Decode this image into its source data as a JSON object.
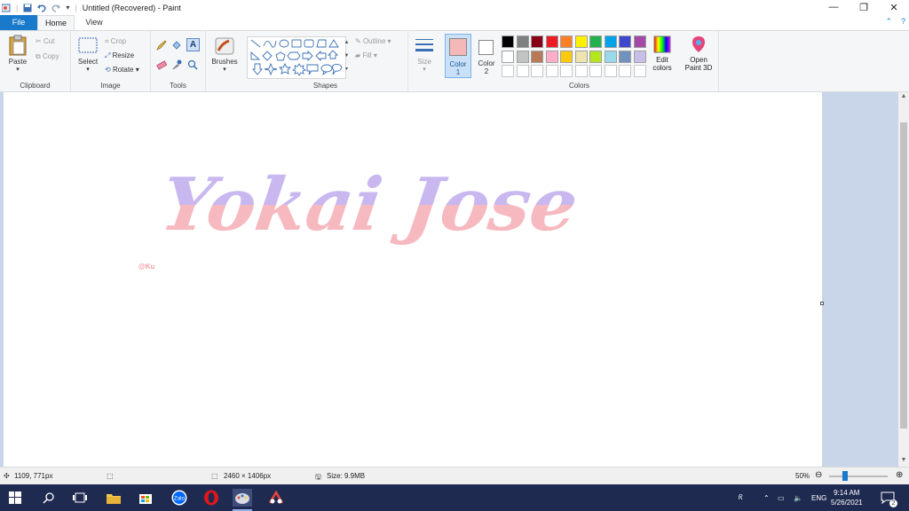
{
  "window": {
    "title": "Untitled (Recovered) - Paint",
    "controls": [
      "minimize",
      "restore",
      "close"
    ]
  },
  "ribbon_tabs": [
    {
      "label": "File"
    },
    {
      "label": "Home"
    },
    {
      "label": "View"
    }
  ],
  "clipboard": {
    "paste": "Paste",
    "cut": "Cut",
    "copy": "Copy",
    "group": "Clipboard"
  },
  "image": {
    "select": "Select",
    "crop": "Crop",
    "resize": "Resize",
    "rotate": "Rotate",
    "group": "Image"
  },
  "tools": {
    "group": "Tools"
  },
  "brushes": {
    "label": "Brushes"
  },
  "shapes": {
    "outline": "Outline",
    "fill": "Fill",
    "group": "Shapes"
  },
  "size": {
    "label": "Size"
  },
  "colors": {
    "color1_line1": "Color",
    "color1_line2": "1",
    "color2_line1": "Color",
    "color2_line2": "2",
    "color1_value": "#f4b8b8",
    "color2_value": "#ffffff",
    "edit_line1": "Edit",
    "edit_line2": "colors",
    "paint3d_line1": "Open",
    "paint3d_line2": "Paint 3D",
    "group": "Colors",
    "palette_row1": [
      "#000000",
      "#7f7f7f",
      "#880015",
      "#ed1c24",
      "#ff7f27",
      "#fff200",
      "#22b14c",
      "#00a2e8",
      "#3f48cc",
      "#a349a4"
    ],
    "palette_row2": [
      "#ffffff",
      "#c3c3c3",
      "#b97a57",
      "#ffaec9",
      "#ffc90e",
      "#efe4b0",
      "#b5e61d",
      "#99d9ea",
      "#7092be",
      "#c8bfe7"
    ]
  },
  "canvas": {
    "artwork_text": "Yokai Jose",
    "credit": "@Ku",
    "top_color": "#c9b8f0",
    "bottom_color": "#f6b9bf"
  },
  "status": {
    "cursor_pos": "1109, 771px",
    "dimensions": "2460 × 1406px",
    "size": "Size: 9.9MB",
    "zoom": "50%"
  },
  "taskbar": {
    "time": "9:14 AM",
    "date": "5/26/2021",
    "lang": "ENG",
    "notifications": "2"
  }
}
